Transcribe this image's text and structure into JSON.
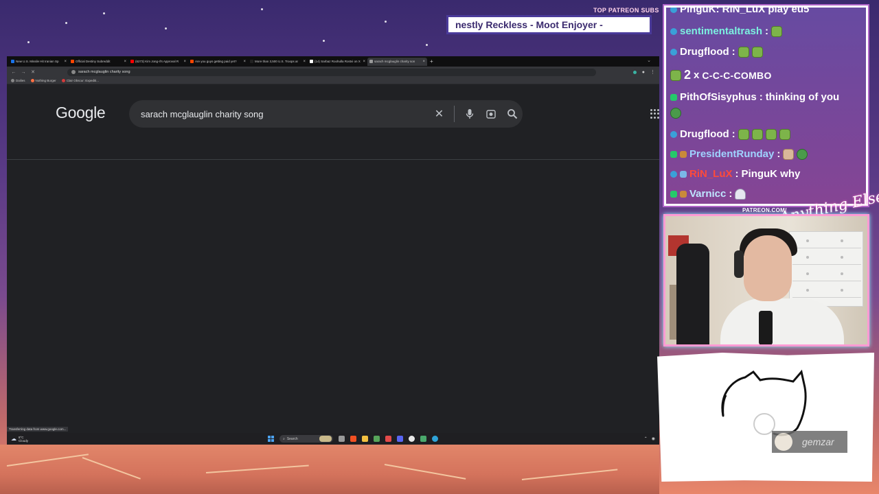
{
  "overlay": {
    "patreon_label": "TOP PATREON SUBS",
    "ticker_text": "nestly Reckless - Moot Enjoyer -",
    "patreon_url": "PATREON.COM/",
    "signature": "Anything Else"
  },
  "browser": {
    "tabs": [
      {
        "label": "New U.S. Missile Hit Iranian Sp",
        "color": "#1a73e8",
        "active": false
      },
      {
        "label": "Official Destiny Subreddit",
        "color": "#ff4500",
        "active": false
      },
      {
        "label": "(6273) Kim Jong-Il's Approval R",
        "color": "#ff0000",
        "active": false
      },
      {
        "label": "Are you guys getting paid yet?",
        "color": "#ff4500",
        "active": false
      },
      {
        "label": "More than 3,500 U.S. Troops ar",
        "color": "#222222",
        "active": false
      },
      {
        "label": "(14) Sarbaz Roohulla Rostvi on X",
        "color": "#ffffff",
        "active": false
      },
      {
        "label": "sarach mcglauglin charity son",
        "color": "#999999",
        "active": true
      }
    ],
    "url": "sarach mcglauglin charity song",
    "bookmarks": [
      {
        "label": "Dailies",
        "color": "#888888"
      },
      {
        "label": "Nothing Burger",
        "color": "#ff7043"
      },
      {
        "label": "Clair Obscur: Expediti...",
        "color": "#d33b3b"
      }
    ],
    "status_text": "Transferring data from www.google.com..."
  },
  "google": {
    "logo": "Google",
    "query": "sarach mcglauglin charity song"
  },
  "taskbar": {
    "weather_temp": "8°C",
    "weather_desc": "Cloudy",
    "search_label": "Search"
  },
  "chat": {
    "top_partial": "PinguK: RiN_LuX play eu5",
    "messages": [
      {
        "user": "sentimentaltrash",
        "user_class": "user-teal",
        "badge": "b-blue",
        "text": "",
        "emotes": 1
      },
      {
        "user": "Drugflood",
        "user_class": "user-white",
        "badge": "b-blue",
        "text": "",
        "emotes": 2
      },
      {
        "user": "PithOfSisyphus",
        "user_class": "user-white",
        "badge": "b-green",
        "text": "thinking of you"
      },
      {
        "user": "Drugflood",
        "user_class": "user-white",
        "badge": "b-blue",
        "text": "",
        "emotes": 4
      },
      {
        "user": "PresidentRunday",
        "user_class": "user-blue",
        "badge": "b-green",
        "text": ""
      },
      {
        "user": "RiN_LuX",
        "user_class": "user-red",
        "badge": "b-blue",
        "text": "PinguK why"
      },
      {
        "user": "Varnicc",
        "user_class": "user-lblue",
        "badge": "b-green",
        "text": ""
      }
    ],
    "combo_count": "2",
    "combo_x": "x",
    "combo_word": "C-C-C-COMBO"
  },
  "donor": {
    "name": "gemzar"
  },
  "colors": {
    "accent_pink": "#ff9ad4",
    "accent_cyan": "#8ff7ff",
    "google_bg": "#202124",
    "search_bg": "#303134"
  }
}
